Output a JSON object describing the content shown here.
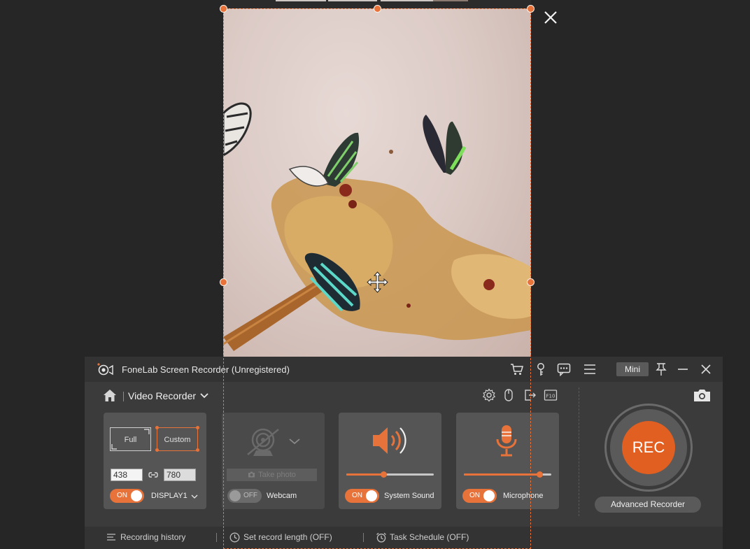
{
  "app": {
    "title": "FoneLab Screen Recorder (Unregistered)",
    "mini_label": "Mini"
  },
  "mode": {
    "label": "Video Recorder"
  },
  "area": {
    "full_label": "Full",
    "custom_label": "Custom",
    "width": "438",
    "height": "780",
    "toggle_label": "ON",
    "display_label": "DISPLAY1"
  },
  "webcam": {
    "take_photo_label": "Take photo",
    "toggle_label": "OFF",
    "label": "Webcam"
  },
  "system_sound": {
    "toggle_label": "ON",
    "label": "System Sound",
    "volume": 0.42
  },
  "microphone": {
    "toggle_label": "ON",
    "label": "Microphone",
    "volume": 0.86
  },
  "record": {
    "rec_label": "REC",
    "advanced_label": "Advanced Recorder"
  },
  "footer": {
    "history_label": "Recording history",
    "length_label": "Set record length (OFF)",
    "schedule_label": "Task Schedule (OFF)"
  },
  "colors": {
    "accent": "#e8733a",
    "rec": "#e05f21"
  }
}
